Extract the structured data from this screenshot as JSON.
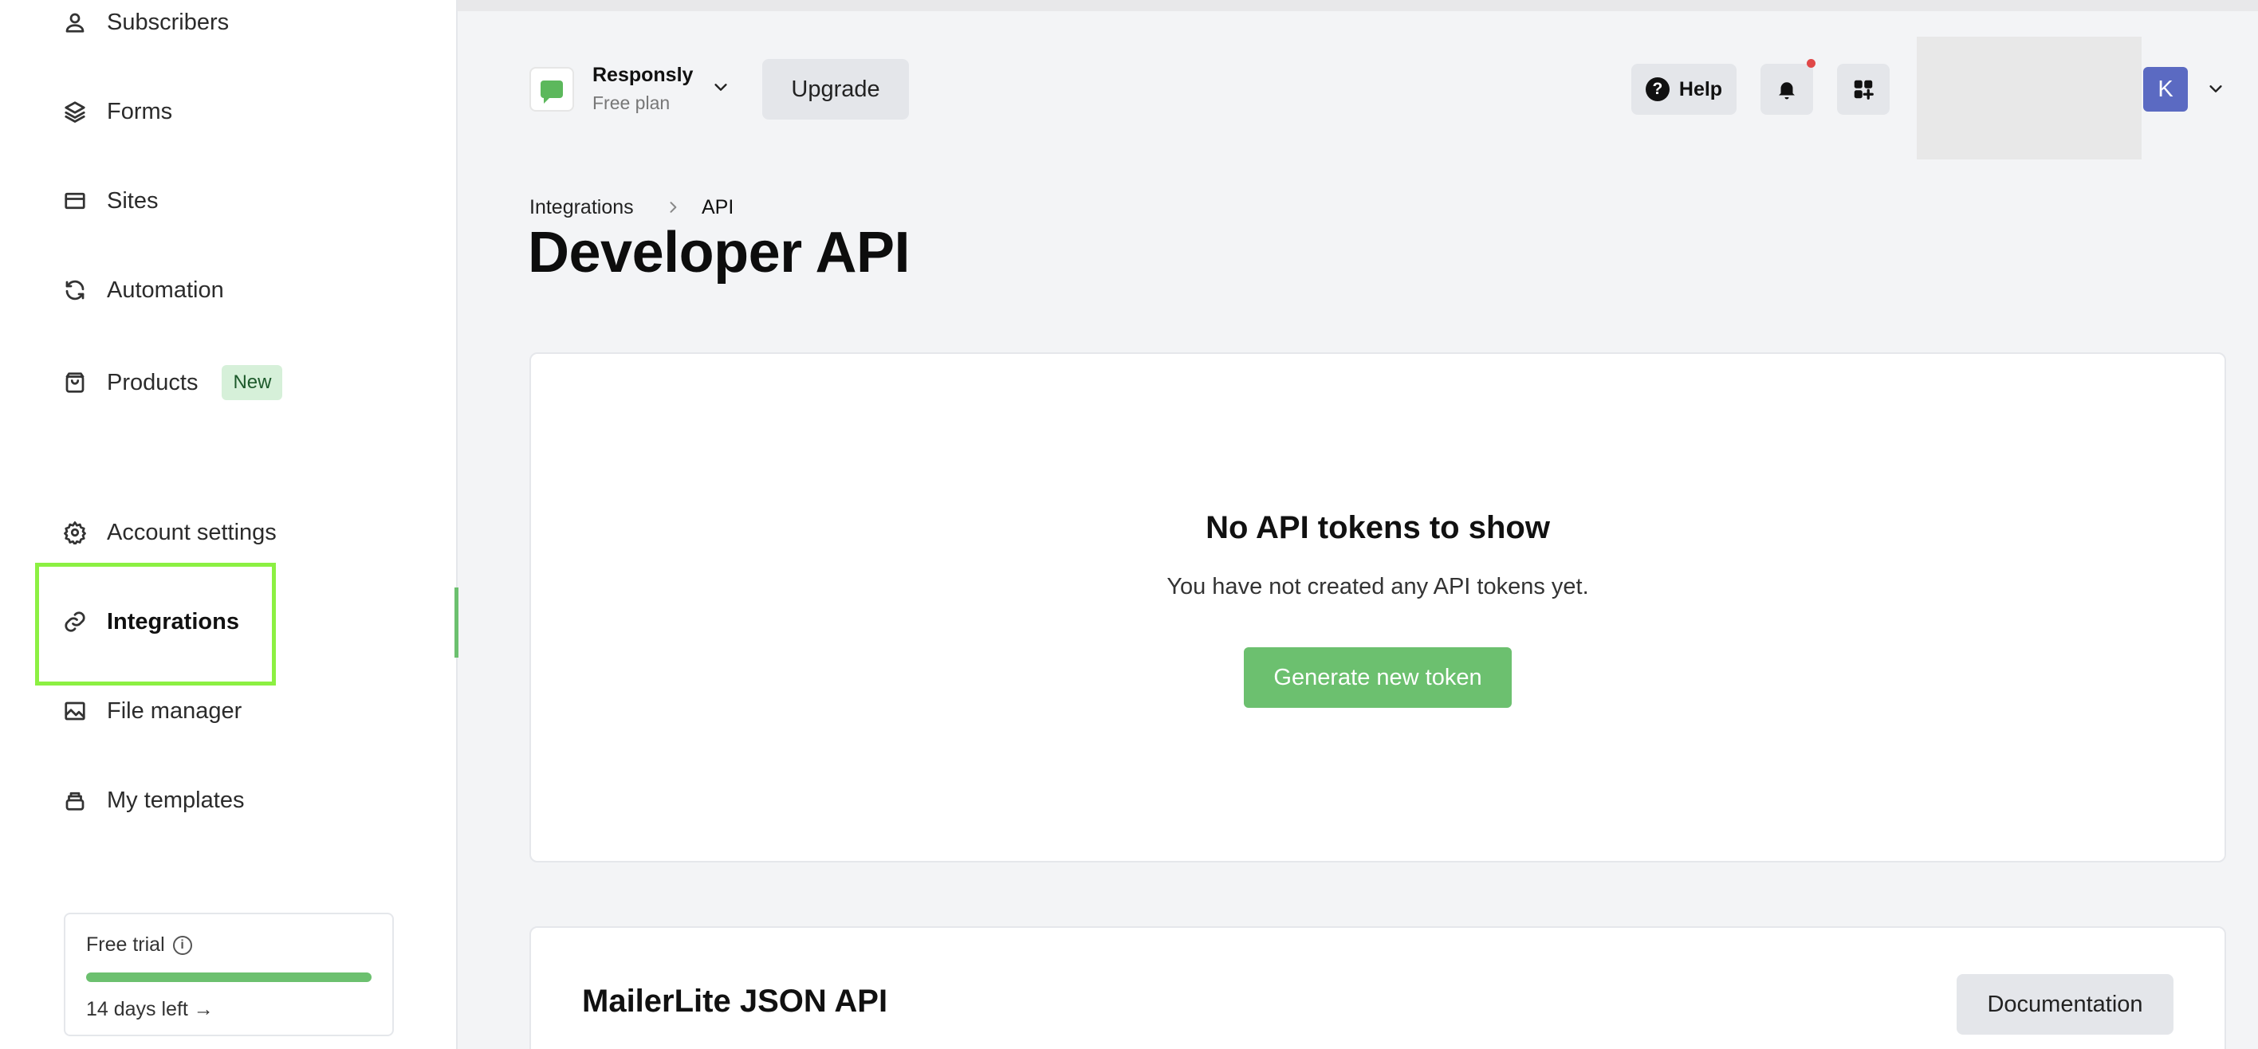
{
  "sidebar": {
    "items": [
      {
        "label": "Subscribers",
        "icon": "user-icon"
      },
      {
        "label": "Forms",
        "icon": "layers-icon"
      },
      {
        "label": "Sites",
        "icon": "browser-icon"
      },
      {
        "label": "Automation",
        "icon": "refresh-icon"
      },
      {
        "label": "Products",
        "icon": "bag-icon",
        "badge": "New"
      },
      {
        "label": "Account settings",
        "icon": "gear-icon"
      },
      {
        "label": "Integrations",
        "icon": "link-icon",
        "active": true
      },
      {
        "label": "File manager",
        "icon": "image-icon"
      },
      {
        "label": "My templates",
        "icon": "stack-icon"
      }
    ],
    "trial": {
      "label": "Free trial",
      "progress": 1.0,
      "days_left": "14 days left →"
    }
  },
  "header": {
    "account_name": "Responsly",
    "plan": "Free plan",
    "upgrade_label": "Upgrade",
    "help_label": "Help",
    "avatar_initial": "K"
  },
  "breadcrumb": {
    "parent": "Integrations",
    "current": "API"
  },
  "page": {
    "title": "Developer API"
  },
  "tokens_card": {
    "empty_title": "No API tokens to show",
    "empty_subtitle": "You have not created any API tokens yet.",
    "generate_label": "Generate new token"
  },
  "api_card": {
    "title": "MailerLite JSON API",
    "docs_label": "Documentation"
  },
  "colors": {
    "accent_green": "#6cc06f",
    "highlight": "#8cf042",
    "avatar": "#5b6ac2",
    "notification": "#e04848"
  }
}
